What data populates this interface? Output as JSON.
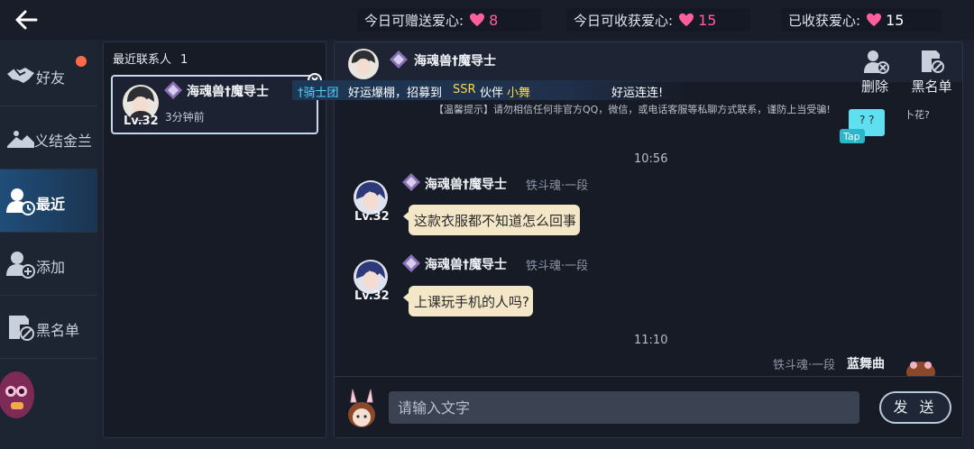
{
  "stats": {
    "can_gift_label": "今日可赠送爱心:",
    "can_gift_value": "8",
    "can_receive_label": "今日可收获爱心:",
    "can_receive_value": "15",
    "received_label": "已收获爱心:",
    "received_value": "15"
  },
  "nav": {
    "items": [
      {
        "label": "好友"
      },
      {
        "label": "义结金兰"
      },
      {
        "label": "最近"
      },
      {
        "label": "添加"
      },
      {
        "label": "黑名单"
      }
    ]
  },
  "contacts": {
    "header": "最近联系人",
    "count": "1",
    "card": {
      "name": "海魂兽†魔导士",
      "level": "Lv.32",
      "time": "3分钟前"
    }
  },
  "chat": {
    "header_name": "海魂兽†魔导士",
    "delete_label": "删除",
    "blacklist_label": "黑名单",
    "broadcast": {
      "p1": "†骑士团",
      "p2": "好运爆棚，招募到",
      "p3": "SSR",
      "p4": "伙伴",
      "p5": "小舞",
      "p6": "好运连连!"
    },
    "warning": "【温馨提示】请勿相信任何非官方QQ，微信，或电话客服等私聊方式联系，谨防上当受骗!",
    "sticker_text": "Tap",
    "corner_text": "卜花?",
    "time1": "10:56",
    "time2": "11:10",
    "messages": [
      {
        "name": "海魂兽†魔导士",
        "rank": "铁斗魂·一段",
        "level": "Lv.32",
        "text": "这款衣服都不知道怎么回事"
      },
      {
        "name": "海魂兽†魔导士",
        "rank": "铁斗魂·一段",
        "level": "Lv.32",
        "text": "上课玩手机的人吗?"
      }
    ],
    "self_rank": "铁斗魂·一段",
    "self_name": "蓝舞曲",
    "input_placeholder": "请输入文字",
    "send_label": "发 送"
  }
}
